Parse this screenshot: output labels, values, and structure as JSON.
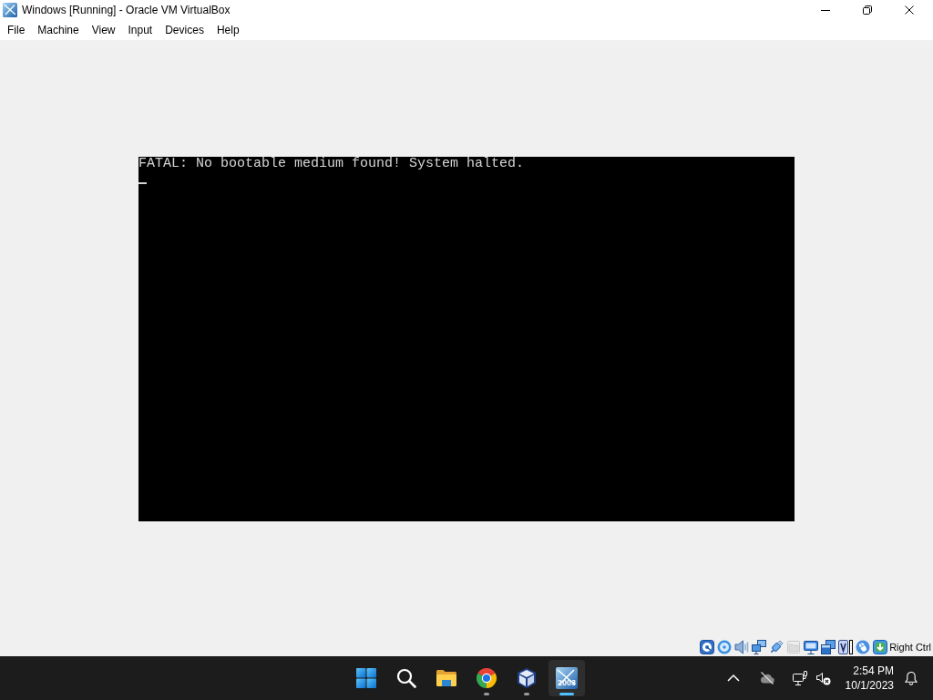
{
  "window": {
    "title": "Windows [Running] - Oracle VM VirtualBox"
  },
  "menu_bar": [
    "File",
    "Machine",
    "View",
    "Input",
    "Devices",
    "Help"
  ],
  "vm_screen": {
    "lines": [
      "FATAL: No bootable medium found! System halted."
    ],
    "cursor": true
  },
  "status_bar": {
    "indicators": [
      {
        "kind": "hard-disk",
        "disabled": false
      },
      {
        "kind": "optical-drive",
        "disabled": false
      },
      {
        "kind": "audio",
        "disabled": false
      },
      {
        "kind": "network",
        "disabled": false
      },
      {
        "kind": "usb",
        "disabled": false
      },
      {
        "kind": "shared-folders",
        "disabled": true
      },
      {
        "kind": "display",
        "disabled": false
      },
      {
        "kind": "recording",
        "disabled": false
      },
      {
        "kind": "features",
        "disabled": false
      },
      {
        "kind": "mouse",
        "disabled": false
      },
      {
        "kind": "keyboard",
        "disabled": false
      }
    ],
    "host_key": "Right Ctrl"
  },
  "taskbar": {
    "apps": [
      {
        "kind": "start",
        "running": false,
        "selected": false
      },
      {
        "kind": "search",
        "running": false,
        "selected": false
      },
      {
        "kind": "file-explorer",
        "running": false,
        "selected": false
      },
      {
        "kind": "browser",
        "running": true,
        "selected": false
      },
      {
        "kind": "virtualbox",
        "running": true,
        "selected": false
      },
      {
        "kind": "vm-window",
        "label": "2003",
        "running": true,
        "selected": true
      }
    ],
    "tray": [
      {
        "kind": "chevron"
      },
      {
        "kind": "cloud-off"
      },
      {
        "kind": "network"
      },
      {
        "kind": "volume-muted"
      }
    ],
    "clock": {
      "time": "2:54 PM",
      "date": "10/1/2023"
    }
  }
}
